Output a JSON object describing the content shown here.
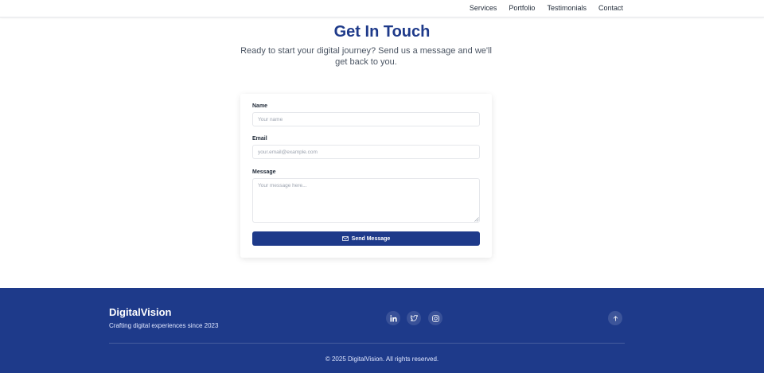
{
  "nav": {
    "links": [
      "Services",
      "Portfolio",
      "Testimonials",
      "Contact"
    ]
  },
  "hero": {
    "title": "Get In Touch",
    "subtitle": "Ready to start your digital journey? Send us a message and we'll get back to you."
  },
  "form": {
    "name_label": "Name",
    "name_placeholder": "Your name",
    "email_label": "Email",
    "email_placeholder": "your.email@example.com",
    "message_label": "Message",
    "message_placeholder": "Your message here...",
    "submit_label": "Send Message",
    "submit_icon": "mail-icon"
  },
  "footer": {
    "brand": "DigitalVision",
    "tagline": "Crafting digital experiences since 2023",
    "social_icons": [
      "linkedin-icon",
      "twitter-icon",
      "instagram-icon"
    ],
    "back_to_top_icon": "arrow-up-icon",
    "copyright": "© 2025 DigitalVision. All rights reserved."
  },
  "colors": {
    "primary": "#1e3a8a",
    "background": "#ffffff",
    "text": "#1f2937",
    "muted": "#4b5563",
    "border": "#e5e7eb"
  }
}
